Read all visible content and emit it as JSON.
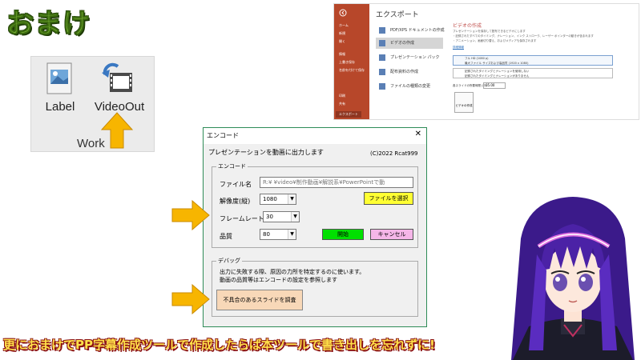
{
  "title": "おまけ",
  "ribbon": {
    "label_button": "Label",
    "videoout_button": "VideoOut",
    "group_label": "Work"
  },
  "powerpoint": {
    "heading": "エクスポート",
    "sidebar": [
      "ホーム",
      "新規",
      "開く",
      "情報",
      "上書き保存",
      "名前を付けて保存",
      "印刷",
      "共有",
      "エクスポート"
    ],
    "options": [
      "PDF/XPS ドキュメントの作成",
      "ビデオの作成",
      "プレゼンテーション パック",
      "配布資料の作成",
      "ファイルの種類の変更"
    ],
    "right_title": "ビデオの作成",
    "right_lines": [
      "プレゼンテーションを保存して配布できるビデオにします",
      "・記録されたすべてのタイミング、ナレーション、インク ストローク、レーザー ポインターの動きが含まれます",
      "・アニメーション、画面切り替え、およびメディアも保存されます"
    ],
    "detail_link": "詳細情報",
    "quality_dropdown": "フル HD (1080 p)",
    "quality_sub": "最大ファイル サイズおよび高品質 (1920 x 1080)",
    "timing_dropdown": "記録されたタイミングとナレーションを使用しない",
    "timing_sub": "記録されたタイミングとナレーションがありません",
    "seconds_label": "各スライドの所要時間 (秒):",
    "seconds_value": "05.00",
    "create_button": "ビデオの作成"
  },
  "dialog": {
    "title": "エンコード",
    "close": "✕",
    "heading": "プレゼンテーションを動画に出力します",
    "copyright": "(C)2022 Rcat999",
    "encode_frame": "エンコード",
    "filename_label": "ファイル名",
    "filename_value": "R:¥     ¥video¥制作動画¥解説系¥PowerPointで動",
    "resolution_label": "解像度(縦)",
    "resolution_value": "1080",
    "select_file_button": "ファイルを選択",
    "framerate_label": "フレームレート",
    "framerate_value": "30",
    "quality_label": "品質",
    "quality_value": "80",
    "start_button": "開始",
    "cancel_button": "キャンセル",
    "debug_frame": "デバッグ",
    "debug_line1": "出力に失敗する際、原因の力所を特定するのに使います。",
    "debug_line2": "動画の品質等はエンコードの設定を参照します",
    "debug_button": "不具合のあるスライドを調査"
  },
  "caption": "更におまけでPP字幕作成ツールで作成したらば本ツールで書き出しを忘れずに!",
  "colors": {
    "title_green": "#8cc63f",
    "arrow_yellow": "#f7b500",
    "pp_red": "#b7472a",
    "dialog_border": "#2e8b57",
    "start_green": "#00e000",
    "cancel_pink": "#f5b6e8",
    "select_yellow": "#ffff33",
    "debug_btn": "#f8d8b8"
  }
}
